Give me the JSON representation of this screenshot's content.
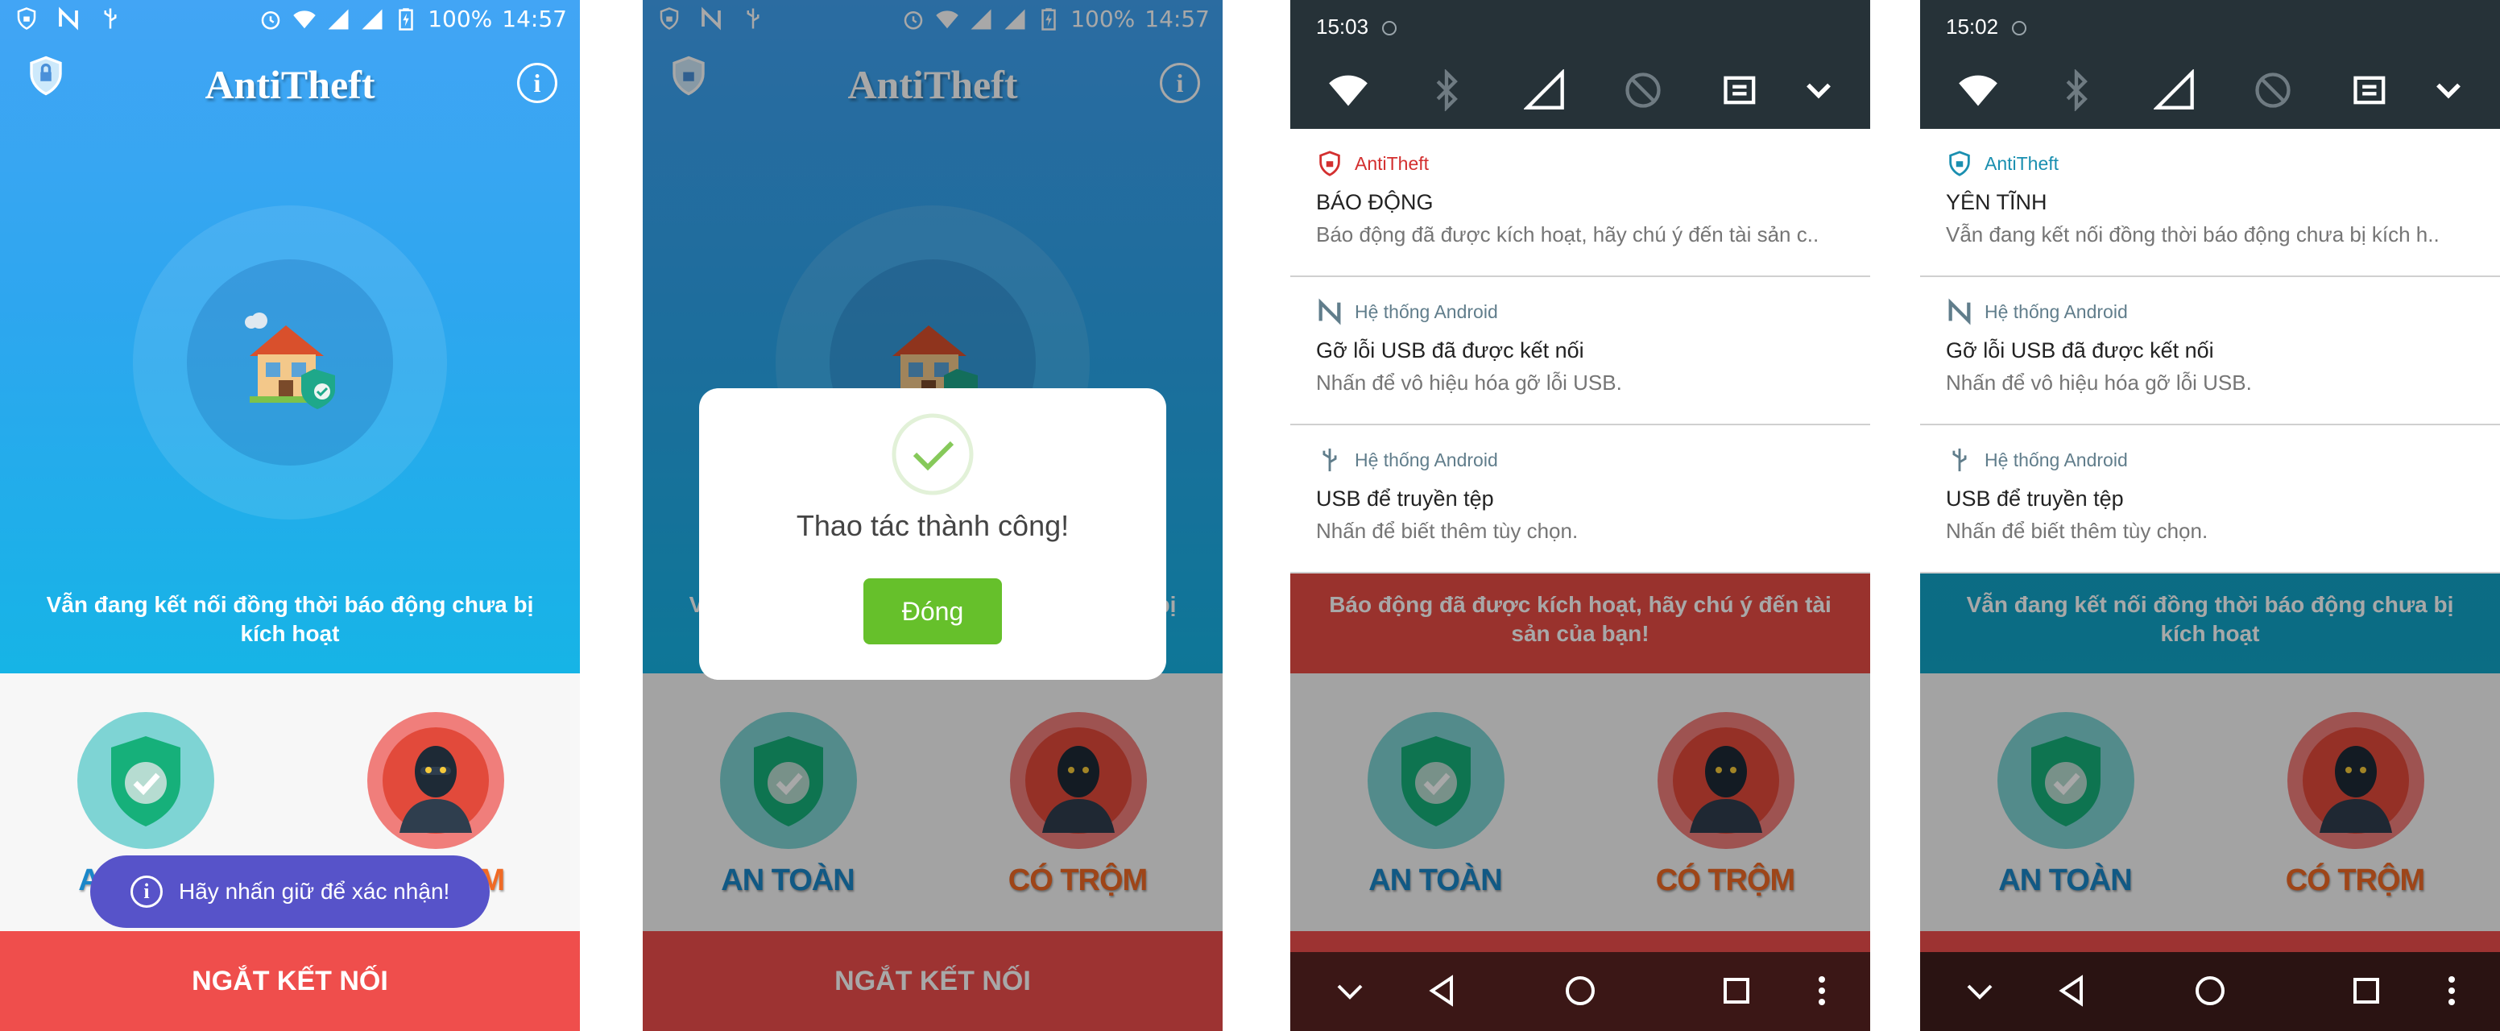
{
  "status": {
    "battery": "100%",
    "time_main": "14:57"
  },
  "app": {
    "title": "AntiTheft",
    "hero_message": "Vẫn đang kết nối đồng thời báo động chưa bị kích hoạt",
    "alarm_message": "Báo động đã được kích hoạt, hãy chú ý đến tài sản của bạn!",
    "safe_label": "AN TOÀN",
    "thief_label": "CÓ TRỘM",
    "disconnect_label": "NGẮT KẾT NỐI",
    "toast_text": "Hãy nhấn giữ để xác nhận!",
    "info_glyph": "i"
  },
  "dialog": {
    "message": "Thao tác thành công!",
    "button": "Đóng"
  },
  "shade_alarm": {
    "time": "15:03",
    "notifications": [
      {
        "app": "AntiTheft",
        "title": "BÁO ĐỘNG",
        "body": "Báo động đã được kích hoạt, hãy chú ý đến tài sản c.."
      },
      {
        "app": "Hệ thống Android",
        "title": "Gỡ lỗi USB đã được kết nối",
        "body": "Nhấn để vô hiệu hóa gỡ lỗi USB."
      },
      {
        "app": "Hệ thống Android",
        "title": "USB để truyền tệp",
        "body": "Nhấn để biết thêm tùy chọn."
      }
    ]
  },
  "shade_quiet": {
    "time": "15:02",
    "notifications": [
      {
        "app": "AntiTheft",
        "title": "YÊN TĨNH",
        "body": "Vẫn đang kết nối đồng thời báo động chưa bị kích h.."
      },
      {
        "app": "Hệ thống Android",
        "title": "Gỡ lỗi USB đã được kết nối",
        "body": "Nhấn để vô hiệu hóa gỡ lỗi USB."
      },
      {
        "app": "Hệ thống Android",
        "title": "USB để truyền tệp",
        "body": "Nhấn để biết thêm tùy chọn."
      }
    ]
  },
  "colors": {
    "accent_blue": "#2ea6ef",
    "disconnect_red": "#ef4e4c",
    "toast_purple": "#5753c9",
    "ok_green": "#66c02b",
    "shade_dark": "#263238"
  }
}
